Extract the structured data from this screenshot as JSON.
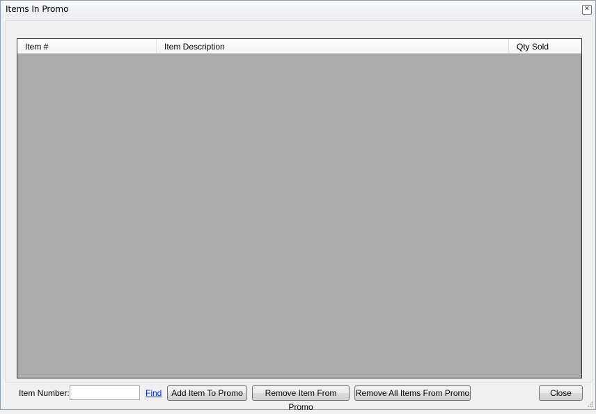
{
  "window": {
    "title": "Items In Promo"
  },
  "table": {
    "columns": [
      "Item #",
      "Item Description",
      "Qty Sold"
    ]
  },
  "footer": {
    "item_number_label": "Item Number:",
    "item_number_value": "",
    "find_link": "Find",
    "add_button": "Add Item To Promo",
    "remove_button": "Remove Item From Promo",
    "remove_all_button": "Remove All Items From Promo",
    "close_button": "Close"
  }
}
